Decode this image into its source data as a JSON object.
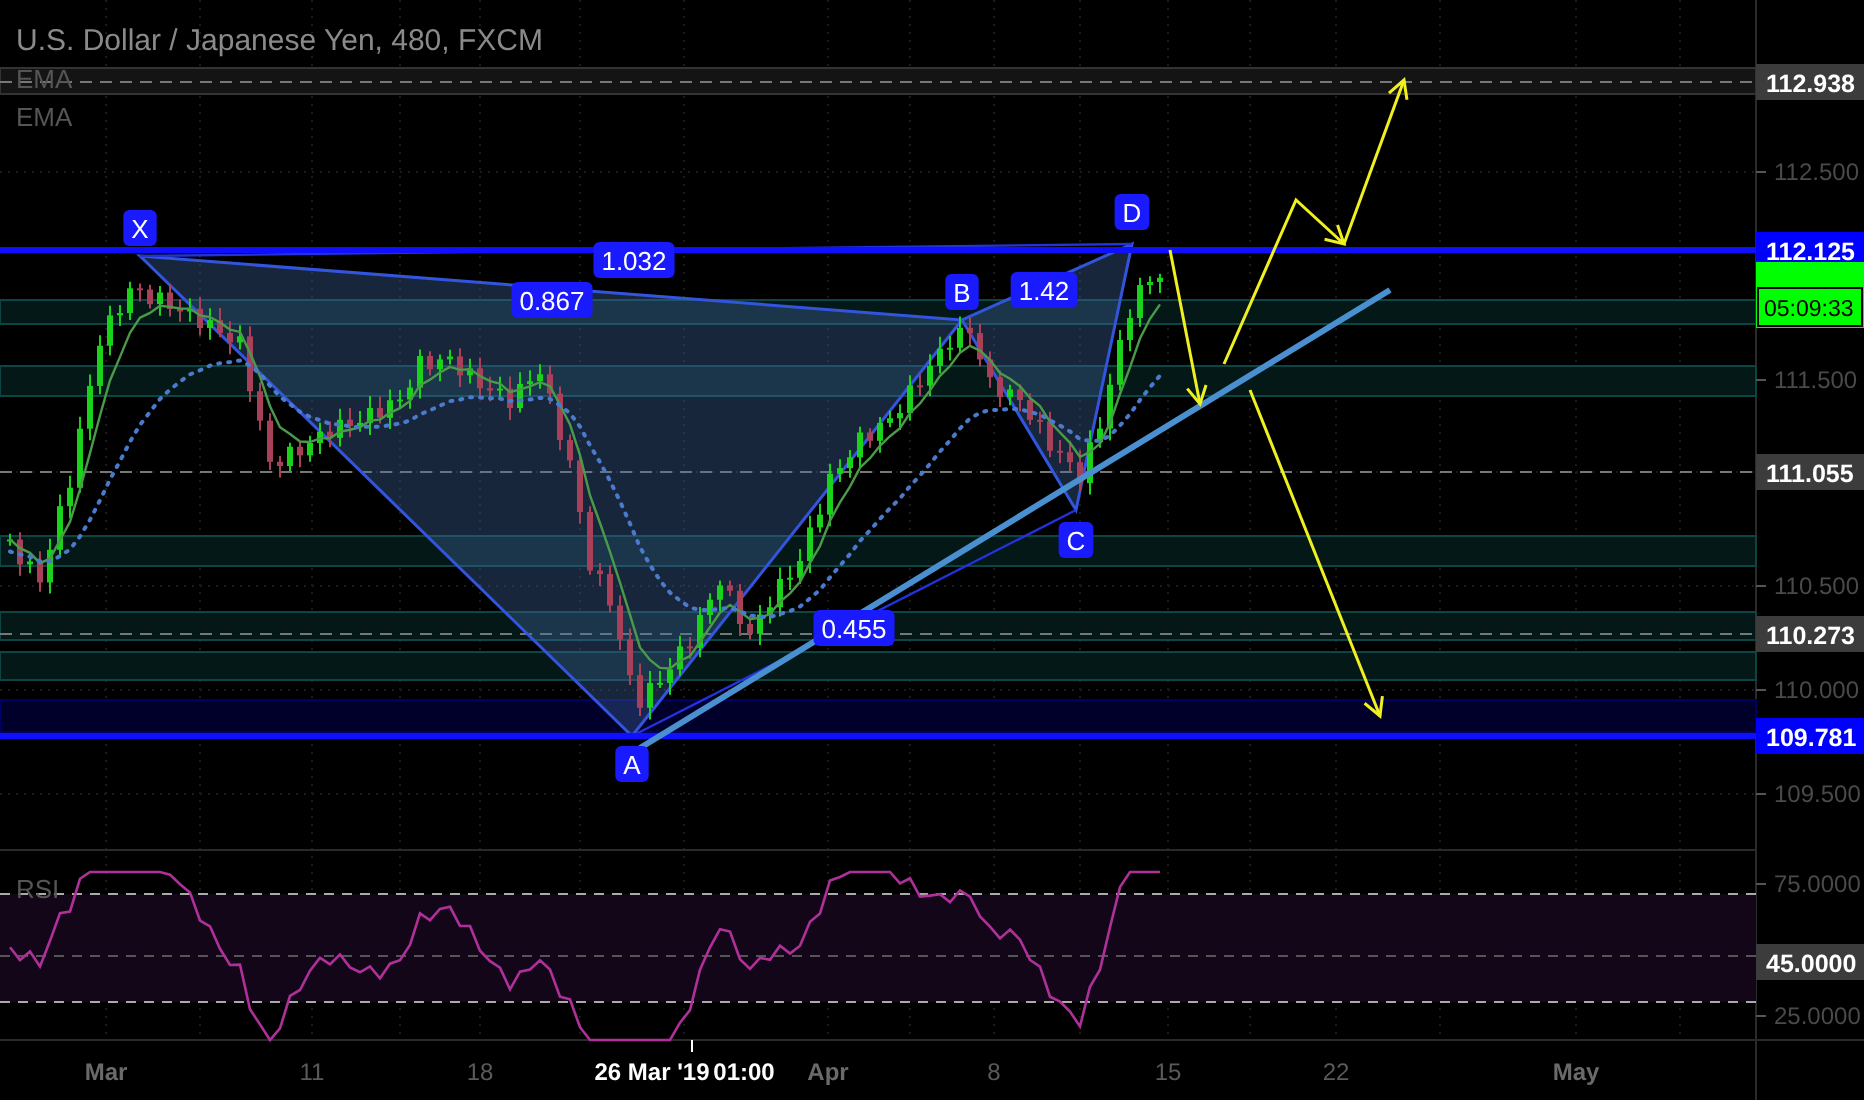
{
  "chart_title": "U.S. Dollar / Japanese Yen, 480, FXCM",
  "indicators": [
    {
      "label": "EMA"
    },
    {
      "label": "EMA"
    }
  ],
  "price_axis": [
    {
      "text": "112.938",
      "kind": "tag",
      "color": "#3c3c3c"
    },
    {
      "text": "112.500",
      "kind": "tick"
    },
    {
      "text": "112.125",
      "kind": "tag",
      "color": "#0000ff"
    },
    {
      "text": "05:09:33",
      "kind": "countdown",
      "color": "#00ff00"
    },
    {
      "text": "111.500",
      "kind": "tick"
    },
    {
      "text": "111.055",
      "kind": "tag",
      "color": "#3c3c3c"
    },
    {
      "text": "110.500",
      "kind": "tick"
    },
    {
      "text": "110.273",
      "kind": "tag",
      "color": "#3c3c3c"
    },
    {
      "text": "110.000",
      "kind": "tick"
    },
    {
      "text": "109.781",
      "kind": "tag",
      "color": "#0000ff"
    },
    {
      "text": "109.500",
      "kind": "tick"
    }
  ],
  "pattern": {
    "points": [
      "X",
      "A",
      "B",
      "C",
      "D"
    ],
    "ratios": [
      "1.032",
      "0.867",
      "1.42",
      "0.455"
    ]
  },
  "rsi": {
    "label": "RSI",
    "axis": [
      {
        "text": "75.0000",
        "kind": "tick"
      },
      {
        "text": "45.0000",
        "kind": "tag",
        "color": "#3c3c3c"
      },
      {
        "text": "25.0000",
        "kind": "tick"
      }
    ]
  },
  "time_axis": [
    {
      "text": "Mar",
      "kind": "month"
    },
    {
      "text": "11",
      "kind": "day"
    },
    {
      "text": "18",
      "kind": "day"
    },
    {
      "text": "26 Mar '19",
      "kind": "cursor"
    },
    {
      "text": "01:00",
      "kind": "cursor"
    },
    {
      "text": "Apr",
      "kind": "month"
    },
    {
      "text": "8",
      "kind": "day"
    },
    {
      "text": "15",
      "kind": "day"
    },
    {
      "text": "22",
      "kind": "day"
    },
    {
      "text": "May",
      "kind": "month"
    }
  ]
}
